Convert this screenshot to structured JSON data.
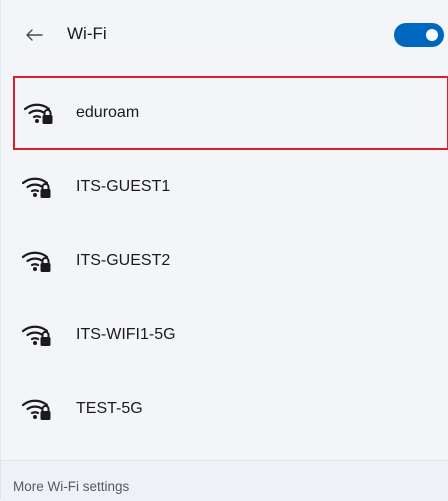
{
  "header": {
    "back_icon": "arrow-left-icon",
    "title": "Wi-Fi",
    "toggle_on": true,
    "accent_color": "#0067c0"
  },
  "networks": [
    {
      "name": "eduroam",
      "icon": "wifi-secured-icon",
      "selected": true
    },
    {
      "name": "ITS-GUEST1",
      "icon": "wifi-secured-icon",
      "selected": false
    },
    {
      "name": "ITS-GUEST2",
      "icon": "wifi-secured-icon",
      "selected": false
    },
    {
      "name": "ITS-WIFI1-5G",
      "icon": "wifi-secured-icon",
      "selected": false
    },
    {
      "name": "TEST-5G",
      "icon": "wifi-secured-icon",
      "selected": false
    }
  ],
  "footer": {
    "more_settings_label": "More Wi-Fi settings"
  },
  "colors": {
    "selection_border": "#d6202c"
  }
}
